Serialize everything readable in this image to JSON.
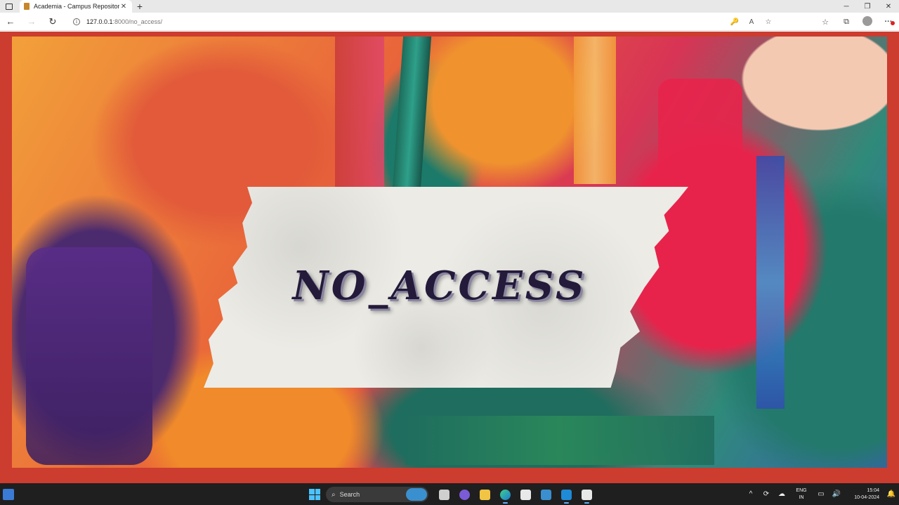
{
  "browser": {
    "tab_title": "Academia - Campus Repository",
    "tab_close": "✕",
    "new_tab": "+",
    "window_controls": [
      "─",
      "❐",
      "✕"
    ],
    "nav": {
      "back": "←",
      "forward": "→",
      "refresh": "↻"
    },
    "address": {
      "host": "127.0.0.1",
      "path": ":8000/no_access/"
    },
    "address_icons": [
      "🔑",
      "A",
      "☆"
    ],
    "toolbar_icons": {
      "favorites": "☆",
      "collections": "⧉",
      "menu": "···"
    }
  },
  "page": {
    "headline": "NO_ACCESS",
    "colors": {
      "frame": "#cc3c2f",
      "text": "#241a3a",
      "tape": "#ecebe6"
    }
  },
  "taskbar": {
    "search_label": "Search",
    "search_icon": "⌕",
    "apps": [
      "file-explorer",
      "teams",
      "folder",
      "edge",
      "store",
      "photos",
      "vscode",
      "snipping-tool"
    ],
    "tray": {
      "chevron": "^",
      "lang_line1": "ENG",
      "lang_line2": "IN",
      "time": "15:04",
      "date": "10-04-2024"
    }
  }
}
